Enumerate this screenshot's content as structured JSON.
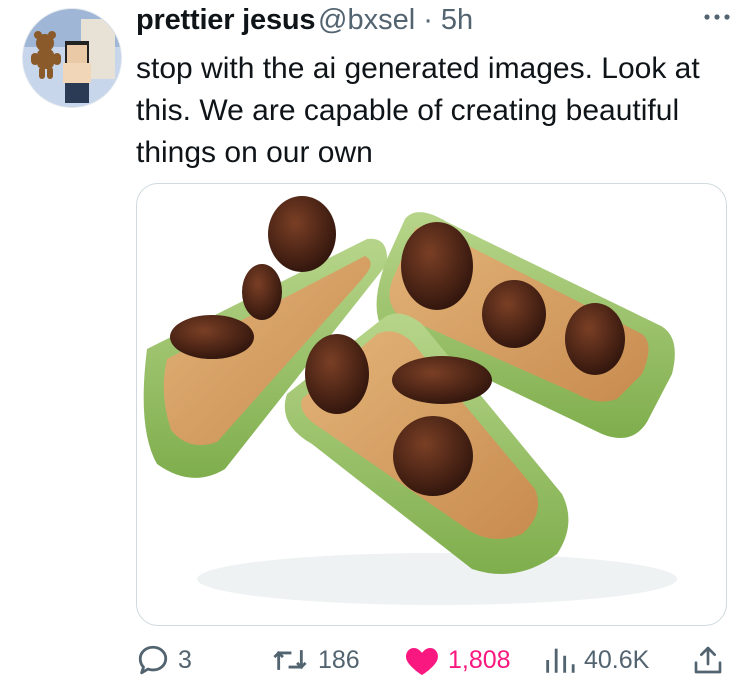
{
  "tweet": {
    "author_name": "prettier jesus",
    "handle_time": "@bxsel · 5h",
    "text": "stop with the ai generated images. Look at this. We are capable of creating beautiful things on our own"
  },
  "media": {
    "subject": "celery sticks with peanut butter and raisins"
  },
  "actions": {
    "replies": "3",
    "retweets": "186",
    "likes": "1,808",
    "views": "40.6K"
  },
  "colors": {
    "like": "#f91880",
    "muted": "#536471",
    "celery": "#9bc36b",
    "peanut_butter": "#d8a468",
    "raisin": "#4a2418"
  },
  "icons": [
    "more-icon",
    "reply-icon",
    "retweet-icon",
    "like-icon",
    "views-icon",
    "share-icon"
  ]
}
